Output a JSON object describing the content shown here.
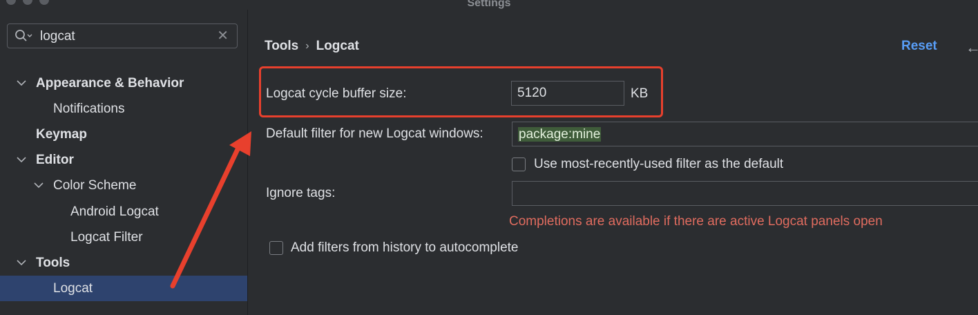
{
  "window": {
    "title": "Settings"
  },
  "search": {
    "value": "logcat"
  },
  "sidebar": {
    "items": [
      {
        "label": "Appearance & Behavior"
      },
      {
        "label": "Notifications"
      },
      {
        "label": "Keymap"
      },
      {
        "label": "Editor"
      },
      {
        "label": "Color Scheme"
      },
      {
        "label": "Android Logcat"
      },
      {
        "label": "Logcat Filter"
      },
      {
        "label": "Tools"
      },
      {
        "label": "Logcat"
      }
    ]
  },
  "header": {
    "breadcrumb": [
      "Tools",
      "Logcat"
    ],
    "reset_label": "Reset"
  },
  "form": {
    "buffer_label": "Logcat cycle buffer size:",
    "buffer_value": "5120",
    "buffer_unit": "KB",
    "filter_label": "Default filter for new Logcat windows:",
    "filter_value": "package:mine",
    "mru_checkbox_label": "Use most-recently-used filter as the default",
    "ignore_tags_label": "Ignore tags:",
    "ignore_tags_value": "",
    "completions_hint": "Completions are available if there are active Logcat panels open",
    "history_checkbox_label": "Add filters from history to autocomplete"
  },
  "colors": {
    "background": "#2b2d30",
    "selection": "#2e436e",
    "accent_link": "#589df6",
    "annotation_red": "#e8402d",
    "hint_red": "#e06c5f",
    "filter_highlight": "#3f5c3a"
  },
  "icons": [
    "search-icon",
    "clear-icon",
    "chevron-down-icon",
    "back-arrow-icon"
  ]
}
